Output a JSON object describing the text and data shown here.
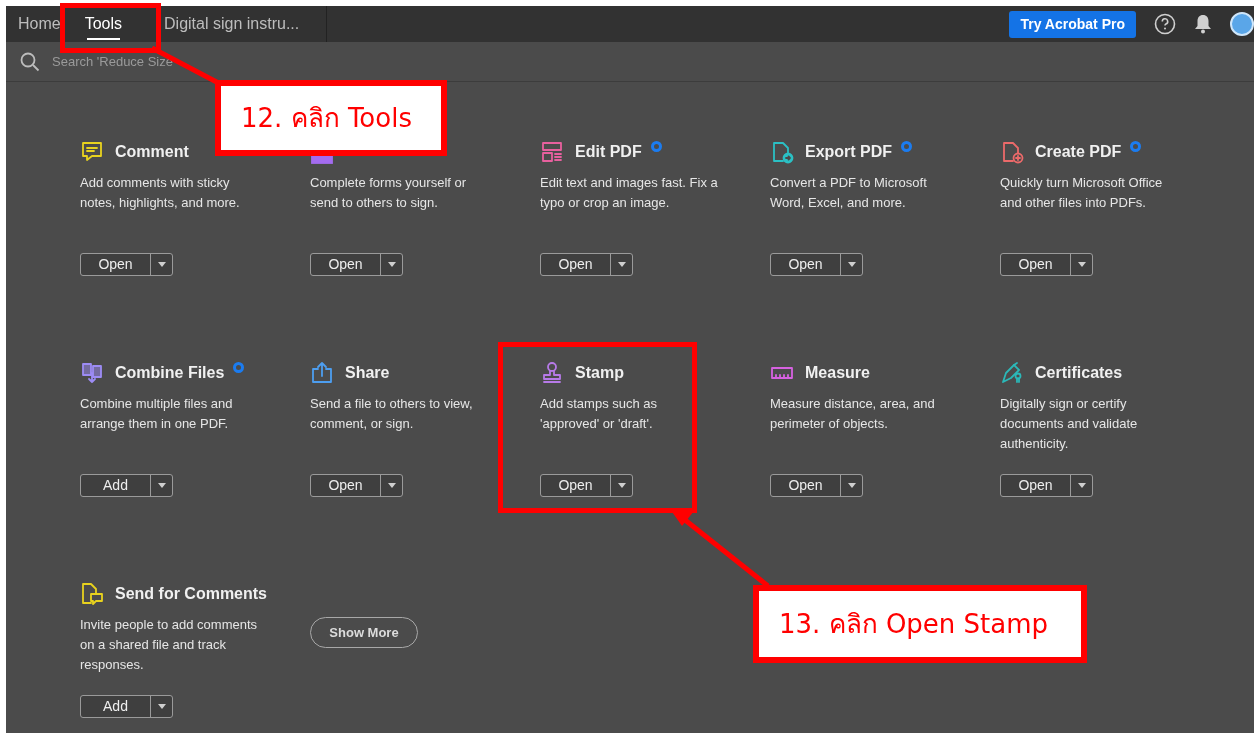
{
  "tabs": [
    {
      "label": "Home",
      "selected": false
    },
    {
      "label": "Tools",
      "selected": true
    },
    {
      "label": "Digital sign instru...",
      "selected": false
    }
  ],
  "header": {
    "upgrade_button": "Try Acrobat Pro"
  },
  "search": {
    "placeholder": "Search 'Reduce Size"
  },
  "tools": [
    {
      "kind": "comment",
      "color": "#e8d21e",
      "title": "Comment",
      "new": false,
      "description": "Add comments with sticky notes, highlights, and more.",
      "action": "Open"
    },
    {
      "kind": "fill-sign",
      "color": "#a46cf0",
      "new": false,
      "description": "Complete forms yourself or send to others to sign.",
      "action": "Open"
    },
    {
      "kind": "edit",
      "color": "#e8609e",
      "title": "Edit PDF",
      "new": true,
      "description": "Edit text and images fast. Fix a typo or crop an image.",
      "action": "Open"
    },
    {
      "kind": "export",
      "color": "#2bc0c4",
      "title": "Export PDF",
      "new": true,
      "description": "Convert a PDF to Microsoft Word, Excel, and more.",
      "action": "Open"
    },
    {
      "kind": "create",
      "color": "#ec6a6a",
      "title": "Create PDF",
      "new": true,
      "description": "Quickly turn Microsoft Office and other files into PDFs.",
      "action": "Open"
    },
    {
      "kind": "combine",
      "color": "#9d8cf5",
      "title": "Combine Files",
      "new": true,
      "description": "Combine multiple files and arrange them in one PDF.",
      "action": "Add"
    },
    {
      "kind": "share",
      "color": "#4d9ef0",
      "title": "Share",
      "new": false,
      "description": "Send a file to others to view, comment, or sign.",
      "action": "Open"
    },
    {
      "kind": "stamp",
      "color": "#b77ae8",
      "title": "Stamp",
      "new": false,
      "description": "Add stamps such as 'approved' or 'draft'.",
      "action": "Open"
    },
    {
      "kind": "measure",
      "color": "#d662e0",
      "title": "Measure",
      "new": false,
      "description": "Measure distance, area, and perimeter of objects.",
      "action": "Open"
    },
    {
      "kind": "certificate",
      "color": "#2bb8b8",
      "title": "Certificates",
      "new": false,
      "description": "Digitally sign or certify documents and validate authenticity.",
      "action": "Open"
    },
    {
      "kind": "send-comments",
      "color": "#e8d21e",
      "title": "Send for Comments",
      "new": false,
      "description": "Invite people to add comments on a shared file and track responses.",
      "action": "Add"
    }
  ],
  "show_more": "Show More",
  "callouts": [
    {
      "text": "12. คลิก Tools"
    },
    {
      "text": "13. คลิก Open Stamp"
    }
  ]
}
